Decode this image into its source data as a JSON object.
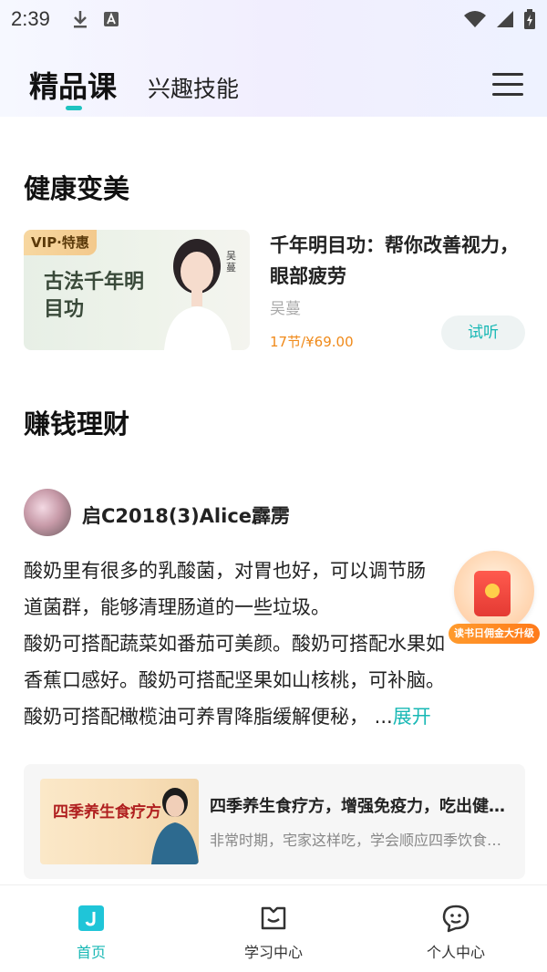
{
  "status_bar": {
    "time": "2:39"
  },
  "tabs": {
    "featured": "精品课",
    "interest": "兴趣技能"
  },
  "sections": {
    "health": {
      "title": "健康变美"
    },
    "finance": {
      "title": "赚钱理财"
    }
  },
  "course": {
    "badge": "VIP·特惠",
    "thumb_title": "古法千年明目功",
    "thumb_name": "吴蔓",
    "title": "千年明目功：帮你改善视力，眼部疲劳",
    "author": "吴蔓",
    "price": "17节/¥69.00",
    "trial_label": "试听"
  },
  "post": {
    "author": "启C2018(3)Alice霹雳",
    "lines": [
      "酸奶里有很多的乳酸菌，对胃也好，可以调节肠",
      "道菌群，能够清理肠道的一些垃圾。",
      "酸奶可搭配蔬菜如番茄可美颜。酸奶可搭配水果如",
      "香蕉口感好。酸奶可搭配坚果如山核桃，可补脑。",
      "酸奶可搭配橄榄油可养胃降脂缓解便秘， ..."
    ],
    "expand_label": "展开"
  },
  "related": {
    "thumb_text": "四季养生食疗方",
    "title": "四季养生食疗方，增强免疫力，吃出健康好身体",
    "subtitle": "非常时期，宅家这样吃，学会顺应四季饮食养生"
  },
  "promo": {
    "label": "读书日佣金大升级"
  },
  "nav": {
    "home": "首页",
    "study": "学习中心",
    "profile": "个人中心"
  },
  "colors": {
    "accent": "#18b8b5",
    "price": "#f08a1a"
  }
}
